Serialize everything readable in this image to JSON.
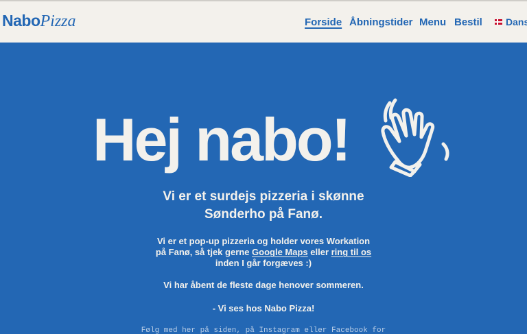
{
  "header": {
    "logo_a": "Nabo",
    "logo_b": "Pizza",
    "nav": [
      "Forside",
      "Åbningstider",
      "Menu",
      "Bestil"
    ],
    "active_nav": "Forside",
    "language": "Dans"
  },
  "hero": {
    "title": "Hej nabo!",
    "wave_icon": "waving-hand-icon",
    "subtitle": "Vi er et surdejs pizzeria i skønne Sønderho på Fanø."
  },
  "content": {
    "p1_a": "Vi er et pop-up pizzeria og holder vores Workation på Fanø, så tjek gerne ",
    "link_maps": "Google Maps",
    "p1_b": " eller ",
    "link_call": "ring til os",
    "p1_c": " inden I går forgæves :)",
    "p2": "Vi har åbent de fleste dage henover sommeren.",
    "p3": "- Vi ses hos Nabo Pizza!",
    "p4": "Følg med her på siden, på Instagram eller Facebook for"
  },
  "colors": {
    "brand_blue": "#2367b4",
    "cream": "#f3f1ec"
  }
}
